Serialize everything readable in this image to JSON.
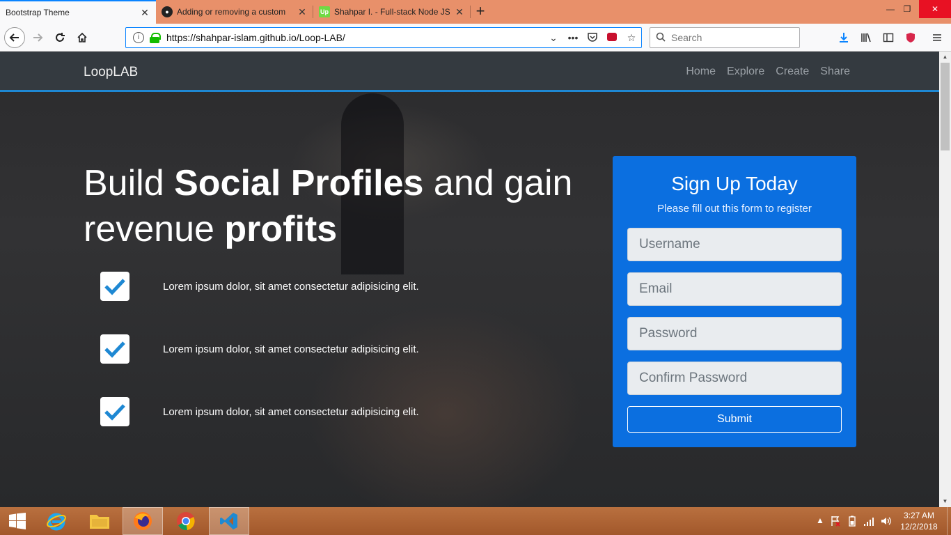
{
  "browser": {
    "tabs": [
      {
        "title": "Bootstrap Theme",
        "active": true,
        "favicon": "none"
      },
      {
        "title": "Adding or removing a custom",
        "active": false,
        "favicon": "github-icon"
      },
      {
        "title": "Shahpar I. - Full-stack Node JS",
        "active": false,
        "favicon": "upwork-icon",
        "favicon_text": "Up"
      }
    ],
    "url": "https://shahpar-islam.github.io/Loop-LAB/",
    "search_placeholder": "Search"
  },
  "site": {
    "brand": "LoopLAB",
    "nav": [
      "Home",
      "Explore",
      "Create",
      "Share"
    ],
    "hero": {
      "title_part1": "Build ",
      "title_bold1": "Social Profiles",
      "title_part2": " and gain revenue ",
      "title_bold2": "profits"
    },
    "features": [
      "Lorem ipsum dolor, sit amet consectetur adipisicing elit.",
      "Lorem ipsum dolor, sit amet consectetur adipisicing elit.",
      "Lorem ipsum dolor, sit amet consectetur adipisicing elit."
    ],
    "signup": {
      "title": "Sign Up Today",
      "subtitle": "Please fill out this form to register",
      "username_placeholder": "Username",
      "email_placeholder": "Email",
      "password_placeholder": "Password",
      "confirm_placeholder": "Confirm Password",
      "submit_label": "Submit"
    }
  },
  "taskbar": {
    "apps": [
      "start-button",
      "internet-explorer",
      "file-explorer",
      "firefox",
      "chrome",
      "vscode"
    ],
    "active_app": "firefox",
    "time": "3:27 AM",
    "date": "12/2/2018"
  },
  "colors": {
    "accent": "#0b6fe0",
    "nav_bg": "#343a40",
    "check": "#1e88d3",
    "taskbar": "#a95f31"
  }
}
